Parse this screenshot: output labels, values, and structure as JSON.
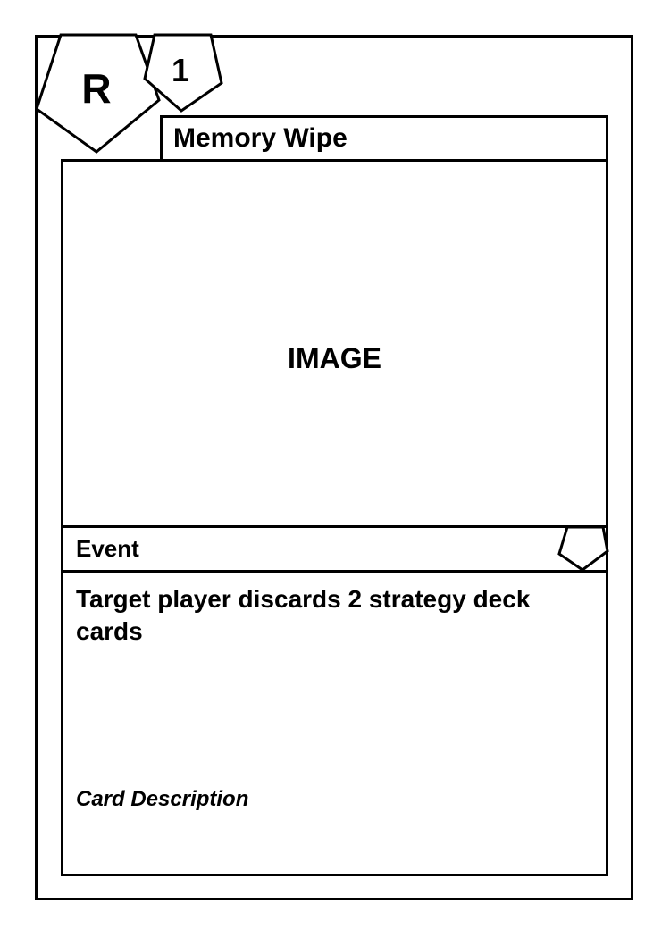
{
  "card": {
    "rarity_symbol": "R",
    "cost": "1",
    "title": "Memory Wipe",
    "image_placeholder": "IMAGE",
    "type_line": "Event",
    "rules_text": "Target player discards 2 strategy deck cards",
    "description": "Card Description"
  },
  "colors": {
    "ink": "#000000",
    "background": "#ffffff"
  },
  "icons": {
    "rarity_badge": "pentagon",
    "cost_badge": "pentagon",
    "type_corner_badge": "pentagon"
  }
}
